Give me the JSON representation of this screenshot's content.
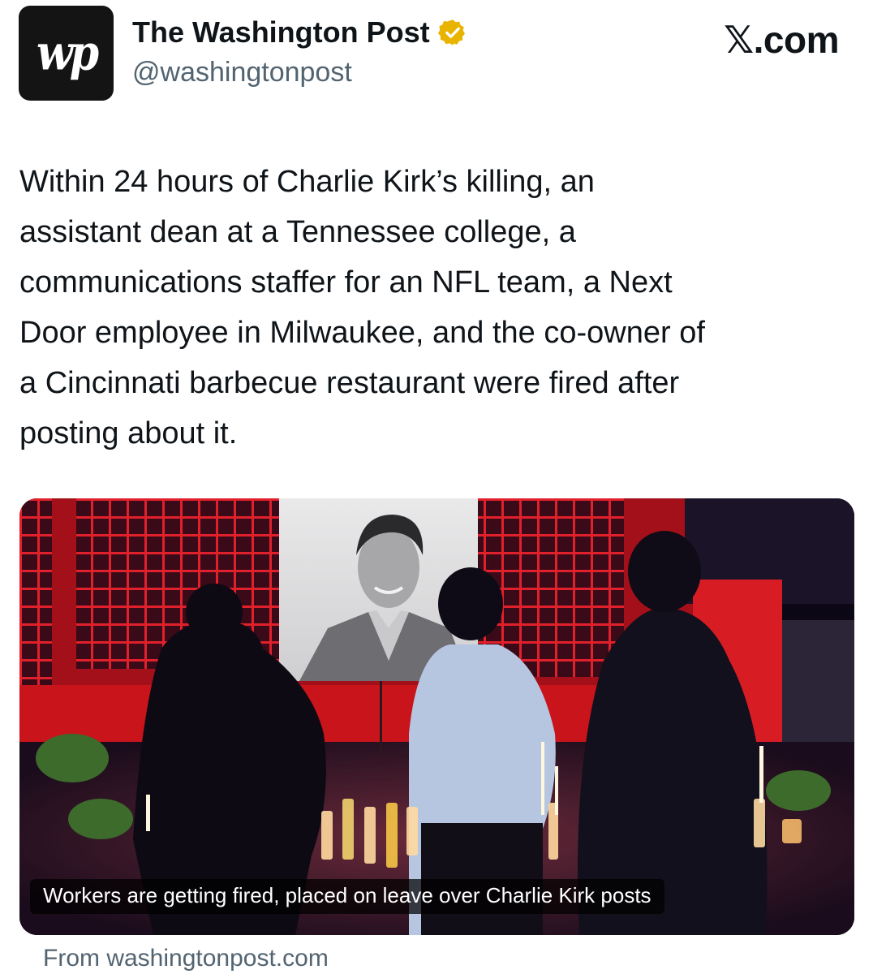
{
  "author": {
    "name": "The Washington Post",
    "handle": "@washingtonpost",
    "avatar_text": "wp",
    "verified_color": "#e8b400"
  },
  "brand": {
    "site": "𝕏.com"
  },
  "tweet": {
    "text": "Within 24 hours of Charlie Kirk’s killing, an\nassistant dean at a Tennessee college, a\ncommunications staffer for an NFL team, a Next\nDoor employee in Milwaukee, and the co-owner of\na Cincinnati barbecue restaurant were fired after\nposting about it."
  },
  "card": {
    "caption": "Workers are getting fired, placed on leave over Charlie Kirk posts",
    "source": "From washingtonpost.com"
  },
  "colors": {
    "text": "#0f1419",
    "secondary": "#536471",
    "stage_red": "#c8141a"
  }
}
